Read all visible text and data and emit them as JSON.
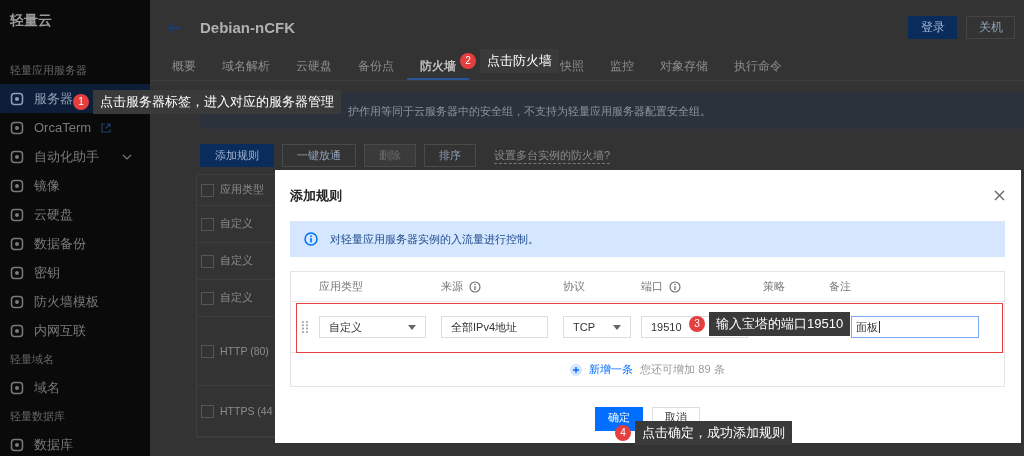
{
  "sidebar": {
    "title": "轻量云",
    "sections": [
      {
        "label": "轻量应用服务器",
        "items": [
          {
            "label": "服务器",
            "kind": "plain",
            "selected": true
          },
          {
            "label": "OrcaTerm",
            "kind": "external",
            "selected": false
          },
          {
            "label": "自动化助手",
            "kind": "expandable",
            "selected": false
          },
          {
            "label": "镜像",
            "kind": "plain",
            "selected": false
          },
          {
            "label": "云硬盘",
            "kind": "plain",
            "selected": false
          },
          {
            "label": "数据备份",
            "kind": "plain",
            "selected": false
          },
          {
            "label": "密钥",
            "kind": "plain",
            "selected": false
          },
          {
            "label": "防火墙模板",
            "kind": "plain",
            "selected": false
          },
          {
            "label": "内网互联",
            "kind": "plain",
            "selected": false
          }
        ]
      },
      {
        "label": "轻量域名",
        "items": [
          {
            "label": "域名",
            "kind": "plain",
            "selected": false
          }
        ]
      },
      {
        "label": "轻量数据库",
        "items": [
          {
            "label": "数据库",
            "kind": "plain",
            "selected": false
          }
        ]
      }
    ]
  },
  "header": {
    "title": "Debian-nCFK",
    "buttons": [
      {
        "label": "登录",
        "kind": "primary"
      },
      {
        "label": "关机",
        "kind": "default"
      }
    ]
  },
  "tabs": [
    {
      "label": "概要",
      "selected": false
    },
    {
      "label": "域名解析",
      "selected": false
    },
    {
      "label": "云硬盘",
      "selected": false
    },
    {
      "label": "备份点",
      "selected": false
    },
    {
      "label": "防火墙",
      "selected": true
    },
    {
      "label": "快照",
      "selected": false
    },
    {
      "label": "监控",
      "selected": false
    },
    {
      "label": "对象存储",
      "selected": false
    },
    {
      "label": "执行命令",
      "selected": false
    }
  ],
  "notice": "护作用等同于云服务器中的安全组，不支持为轻量应用服务器配置安全组。",
  "toolbar": {
    "buttons": [
      {
        "label": "添加规则",
        "kind": "primary"
      },
      {
        "label": "一键放通",
        "kind": "default"
      },
      {
        "label": "删除",
        "kind": "disabled"
      },
      {
        "label": "排序",
        "kind": "default"
      }
    ],
    "link": "设置多台实例的防火墙?"
  },
  "table": {
    "columns": [
      "应用类型"
    ],
    "header_checked": false,
    "rows": [
      {
        "cell": "自定义",
        "checked": false
      },
      {
        "cell": "自定义",
        "checked": false
      },
      {
        "cell": "自定义",
        "checked": false
      },
      {
        "cell": "HTTP (80)",
        "checked": false
      },
      {
        "cell": "HTTPS (44",
        "checked": false
      }
    ]
  },
  "dialog": {
    "title": "添加规则",
    "notice": "对轻量应用服务器实例的入流量进行控制。",
    "columns": [
      {
        "label": "应用类型",
        "info": false
      },
      {
        "label": "来源",
        "info": true
      },
      {
        "label": "协议",
        "info": false
      },
      {
        "label": "端口",
        "info": true
      },
      {
        "label": "策略",
        "info": false
      },
      {
        "label": "备注",
        "info": false
      }
    ],
    "rule": {
      "type": "自定义",
      "source": "全部IPv4地址",
      "protocol": "TCP",
      "port": "19510",
      "note": "面板"
    },
    "add_link": "新增一条",
    "remaining": "您还可增加 89 条",
    "buttons": [
      {
        "label": "确定",
        "kind": "primary"
      },
      {
        "label": "取消",
        "kind": "default"
      }
    ]
  },
  "callouts": [
    {
      "number": "1",
      "text": "点击服务器标签，进入对应的服务器管理"
    },
    {
      "number": "2",
      "text": "点击防火墙"
    },
    {
      "number": "3",
      "text": "输入宝塔的端口19510"
    },
    {
      "number": "4",
      "text": "点击确定，成功添加规则"
    }
  ]
}
